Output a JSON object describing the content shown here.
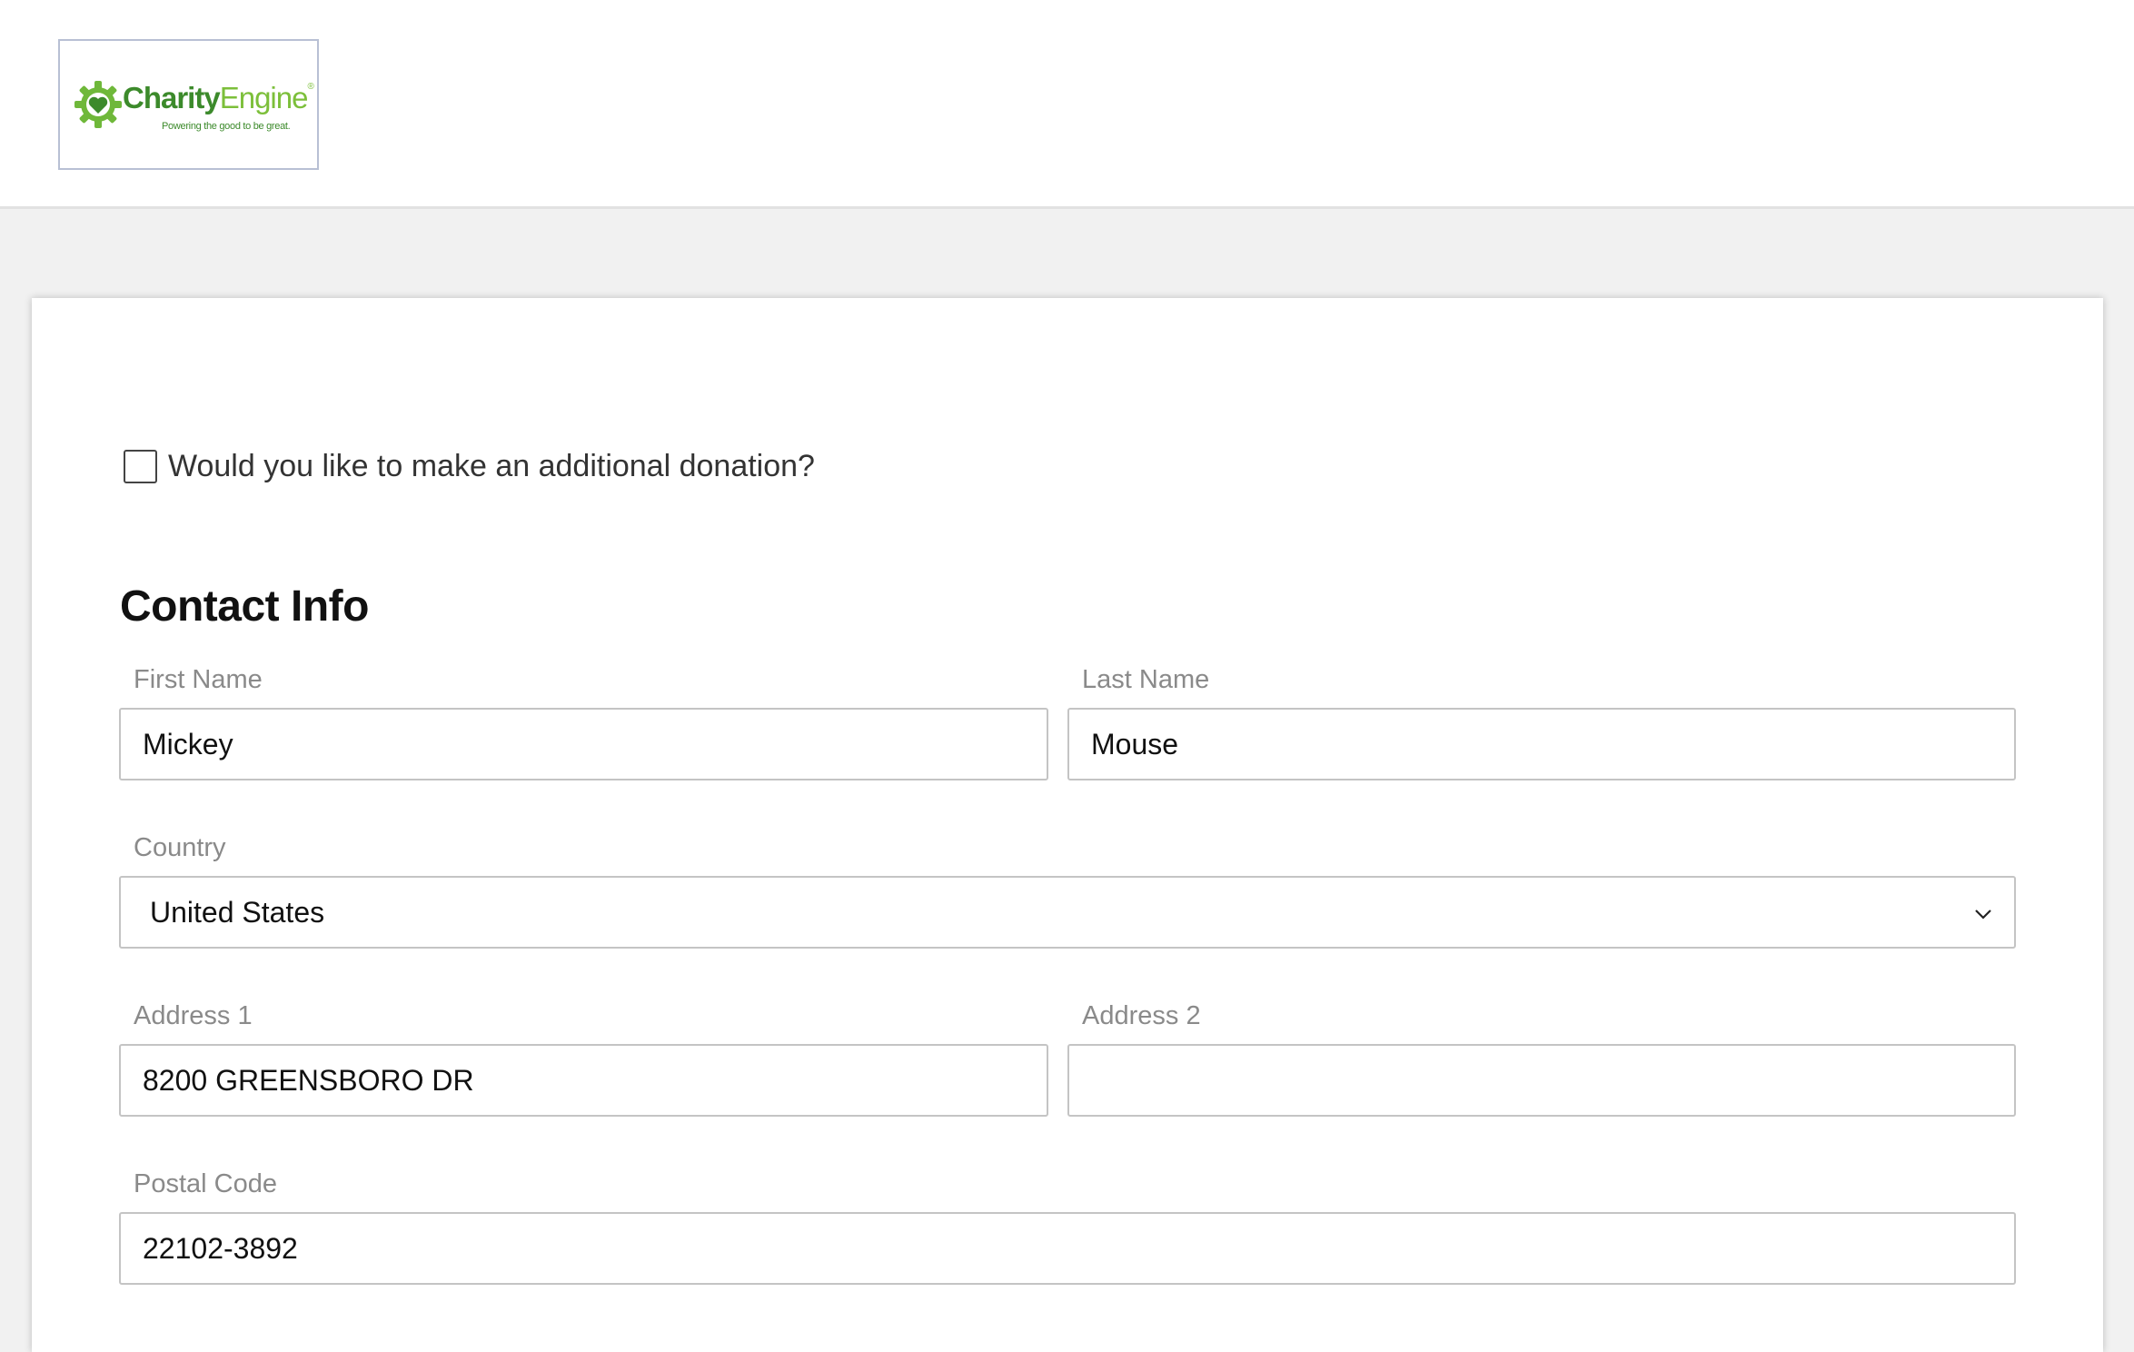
{
  "header": {
    "logo": {
      "name_part1": "Charity",
      "name_part2": "Engine",
      "registered": "®",
      "tagline": "Powering the good to be great."
    }
  },
  "form": {
    "donation_checkbox": {
      "label": "Would you like to make an additional donation?",
      "checked": false
    },
    "section_title": "Contact Info",
    "first_name": {
      "label": "First Name",
      "value": "Mickey"
    },
    "last_name": {
      "label": "Last Name",
      "value": "Mouse"
    },
    "country": {
      "label": "Country",
      "value": "United States"
    },
    "address1": {
      "label": "Address 1",
      "value": "8200 GREENSBORO DR"
    },
    "address2": {
      "label": "Address 2",
      "value": ""
    },
    "postal_code": {
      "label": "Postal Code",
      "value": "22102-3892"
    }
  },
  "colors": {
    "brand_dark_green": "#3c8a2b",
    "brand_light_green": "#7cbf3a",
    "label_gray": "#8a8a8a",
    "input_border": "#c4c4c4"
  }
}
